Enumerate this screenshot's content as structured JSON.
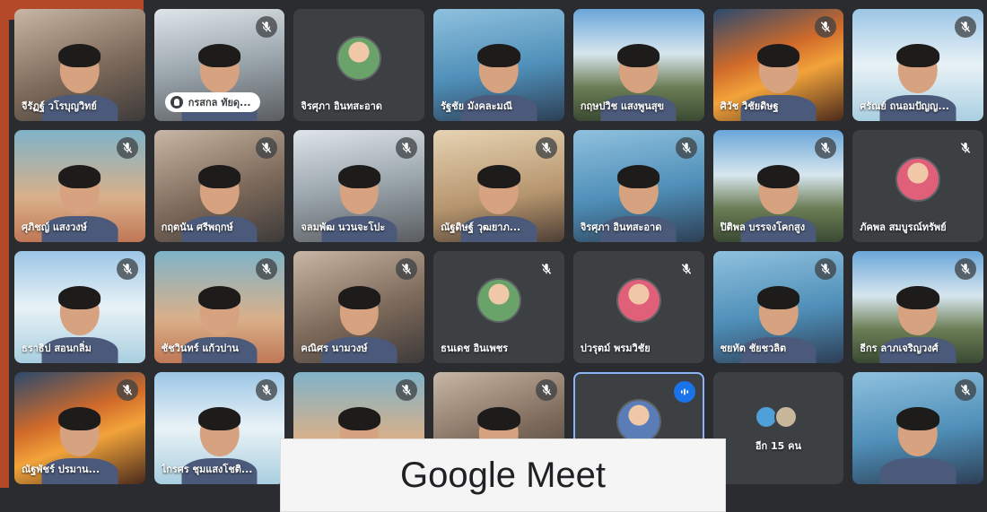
{
  "app": {
    "caption": "Google Meet"
  },
  "tiles": [
    {
      "name": "จีรัฏฐ์ วโรบุญวิทย์",
      "kind": "video",
      "muted": false
    },
    {
      "name": "กรสกล ทัยดุ...",
      "kind": "video",
      "muted": true,
      "pill": true
    },
    {
      "name": "จิรศุภา อินทสะอาด",
      "kind": "avatar",
      "muted": false
    },
    {
      "name": "รัฐชัย มังคละมณี",
      "kind": "video",
      "muted": false
    },
    {
      "name": "กฤษปวิช แสงพูนสุข",
      "kind": "video",
      "muted": false
    },
    {
      "name": "ศิวัช วิชัยดิษฐ",
      "kind": "video",
      "muted": true
    },
    {
      "name": "ศรัณย์ ถนอมปัญญ...",
      "kind": "video",
      "muted": true
    },
    {
      "name": "ศุภิชญ์ แสงวงษ์",
      "kind": "video",
      "muted": true
    },
    {
      "name": "กฤตนัน ศรีพฤกษ์",
      "kind": "video",
      "muted": true
    },
    {
      "name": "จลมพัฒ นวนจะโปะ",
      "kind": "video",
      "muted": true
    },
    {
      "name": "ณัฐดิษฐ์ วุฒยาภ...",
      "kind": "video",
      "muted": true
    },
    {
      "name": "จิรศุภา อินทสะอาด",
      "kind": "video",
      "muted": true
    },
    {
      "name": "ปิติพล บรรจงโคกสูง",
      "kind": "video",
      "muted": true
    },
    {
      "name": "ภัคพล สมบูรณ์ทรัพย์",
      "kind": "avatar",
      "muted": true
    },
    {
      "name": "ธราธิป สอนกลิ่ม",
      "kind": "video",
      "muted": true
    },
    {
      "name": "ชัชวินทร์ แก้วปาน",
      "kind": "video",
      "muted": true
    },
    {
      "name": "คณิศร นามวงษ์",
      "kind": "video",
      "muted": true
    },
    {
      "name": "ธนเดช อินเพชร",
      "kind": "avatar",
      "muted": true
    },
    {
      "name": "ปวรุตม์ พรมวิชัย",
      "kind": "avatar",
      "muted": true
    },
    {
      "name": "ชยทัต ชัยชวลิต",
      "kind": "video",
      "muted": true
    },
    {
      "name": "ธีกร ลาภเจริญวงศ์",
      "kind": "video",
      "muted": true
    },
    {
      "name": "ณัฐพัชร์ ปรมาน...",
      "kind": "video",
      "muted": true
    },
    {
      "name": "ไกรศร ชุมแสงโชติ...",
      "kind": "video",
      "muted": true
    },
    {
      "name": "",
      "kind": "video",
      "muted": true
    },
    {
      "name": "",
      "kind": "video",
      "muted": true
    },
    {
      "name": "",
      "kind": "avatar",
      "muted": false,
      "speaking": true
    },
    {
      "name": "อีก 15 คน",
      "kind": "more",
      "muted": false
    },
    {
      "name": "",
      "kind": "video",
      "muted": true
    }
  ],
  "icons": {
    "muted": "mic-off-icon",
    "speaking": "audio-level-icon",
    "raised_hand": "raised-hand-icon"
  },
  "colors": {
    "accent": "#b4492a",
    "tile_bg": "#3c4043",
    "speaking_blue": "#1a73e8",
    "page_bg": "#2a2c30"
  }
}
